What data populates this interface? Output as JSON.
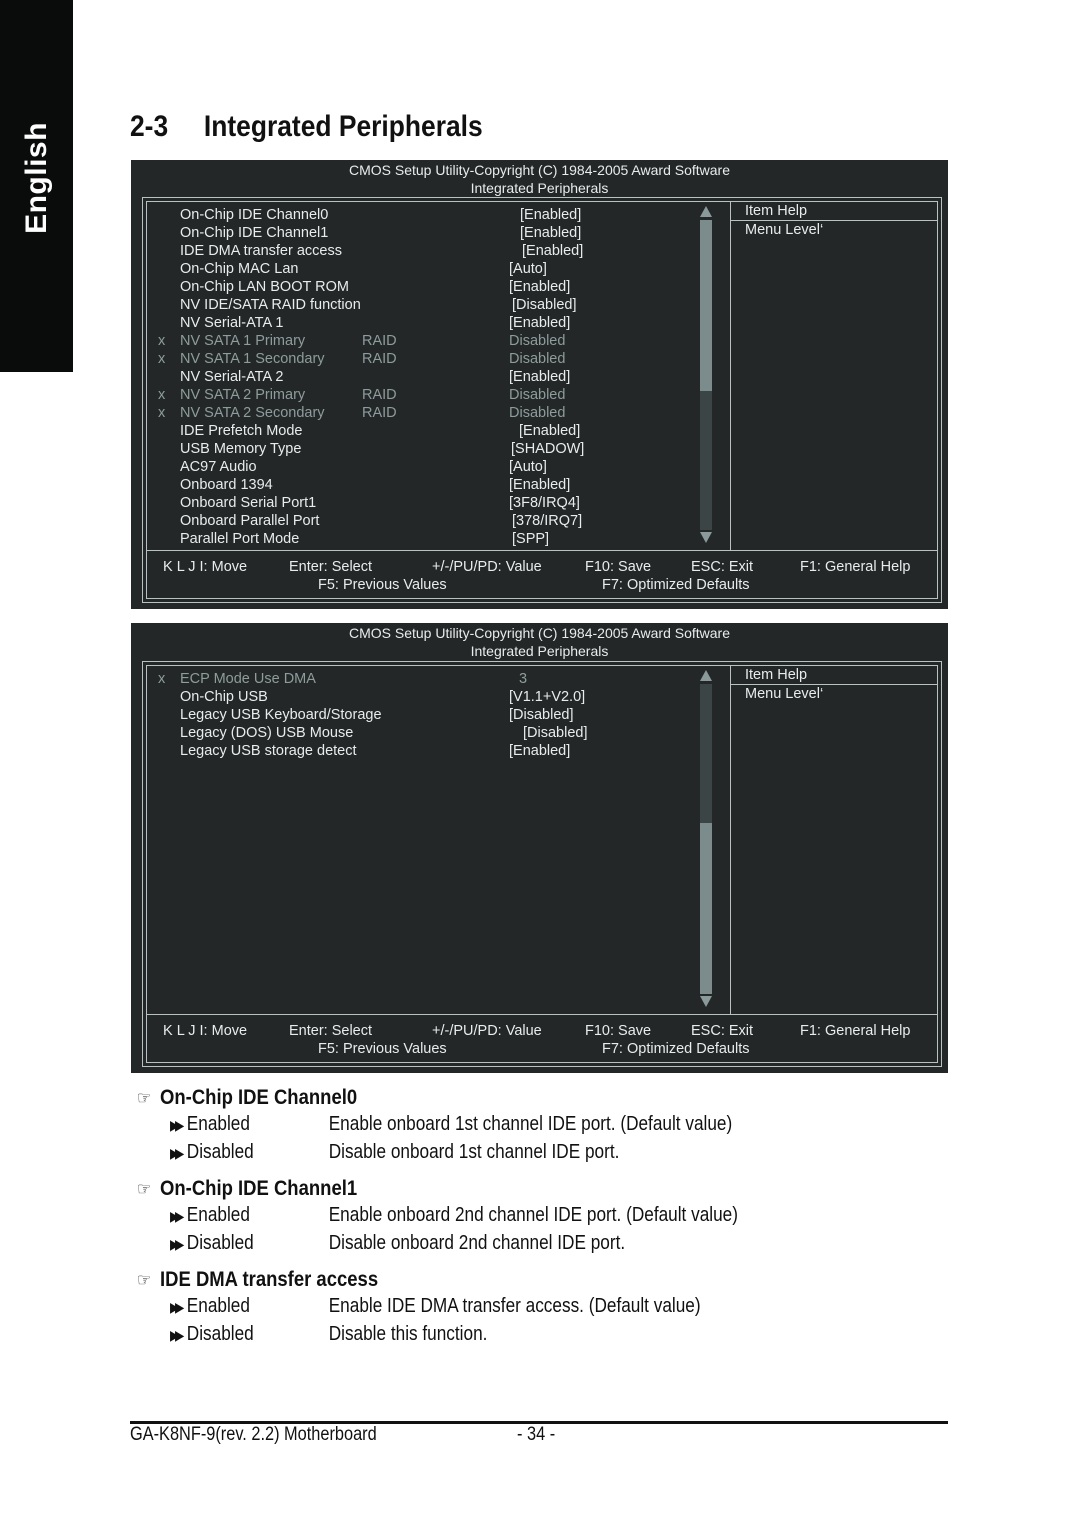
{
  "side_tab": {
    "label": "English"
  },
  "section": {
    "number": "2-3",
    "title": "Integrated Peripherals"
  },
  "bios_screens": [
    {
      "header_line1": "CMOS Setup Utility-Copyright (C) 1984-2005 Award Software",
      "header_line2": "Integrated Peripherals",
      "items": [
        {
          "prefix": "",
          "label": "On-Chip IDE Channel0",
          "raid": "",
          "value": "[Enabled]",
          "disabled": false
        },
        {
          "prefix": "",
          "label": "On-Chip IDE Channel1",
          "raid": "",
          "value": "[Enabled]",
          "disabled": false
        },
        {
          "prefix": "",
          "label": "IDE DMA transfer access",
          "raid": "",
          "value": "[Enabled]",
          "disabled": false
        },
        {
          "prefix": "",
          "label": "On-Chip MAC Lan",
          "raid": "",
          "value": "[Auto]",
          "disabled": false
        },
        {
          "prefix": "",
          "label": "On-Chip LAN BOOT ROM",
          "raid": "",
          "value": "[Enabled]",
          "disabled": false
        },
        {
          "prefix": "",
          "label": "NV IDE/SATA RAID function",
          "raid": "",
          "value": "[Disabled]",
          "disabled": false
        },
        {
          "prefix": "",
          "label": "NV Serial-ATA 1",
          "raid": "",
          "value": "[Enabled]",
          "disabled": false
        },
        {
          "prefix": "x",
          "label": "NV SATA 1 Primary",
          "raid": "RAID",
          "value": "Disabled",
          "disabled": true
        },
        {
          "prefix": "x",
          "label": "NV SATA 1 Secondary",
          "raid": "RAID",
          "value": "Disabled",
          "disabled": true
        },
        {
          "prefix": "",
          "label": "NV Serial-ATA 2",
          "raid": "",
          "value": "[Enabled]",
          "disabled": false
        },
        {
          "prefix": "x",
          "label": "NV SATA 2 Primary",
          "raid": "RAID",
          "value": "Disabled",
          "disabled": true
        },
        {
          "prefix": "x",
          "label": "NV SATA 2 Secondary",
          "raid": "RAID",
          "value": "Disabled",
          "disabled": true
        },
        {
          "prefix": "",
          "label": "IDE Prefetch Mode",
          "raid": "",
          "value": "[Enabled]",
          "disabled": false
        },
        {
          "prefix": "",
          "label": "USB Memory Type",
          "raid": "",
          "value": "[SHADOW]",
          "disabled": false
        },
        {
          "prefix": "",
          "label": "AC97 Audio",
          "raid": "",
          "value": "[Auto]",
          "disabled": false
        },
        {
          "prefix": "",
          "label": "Onboard 1394",
          "raid": "",
          "value": "[Enabled]",
          "disabled": false
        },
        {
          "prefix": "",
          "label": "Onboard Serial Port1",
          "raid": "",
          "value": "[3F8/IRQ4]",
          "disabled": false
        },
        {
          "prefix": "",
          "label": "Onboard Parallel Port",
          "raid": "",
          "value": "[378/IRQ7]",
          "disabled": false
        },
        {
          "prefix": "",
          "label": "Parallel Port Mode",
          "raid": "",
          "value": "[SPP]",
          "disabled": false
        }
      ],
      "scroll_position": "top",
      "scroll_thumb_fraction": 0.55,
      "item_help_title": "Item Help",
      "menu_level": "Menu Level‘",
      "footer": {
        "move": "K L J I: Move",
        "enter": "Enter: Select",
        "value": "+/-/PU/PD: Value",
        "save": "F10: Save",
        "exit": "ESC: Exit",
        "help": "F1: General Help",
        "previous": "F5: Previous Values",
        "defaults": "F7: Optimized Defaults"
      }
    },
    {
      "header_line1": "CMOS Setup Utility-Copyright (C) 1984-2005 Award Software",
      "header_line2": "Integrated Peripherals",
      "items": [
        {
          "prefix": "x",
          "label": "ECP Mode Use DMA",
          "raid": "",
          "value": "3",
          "disabled": true
        },
        {
          "prefix": "",
          "label": "On-Chip USB",
          "raid": "",
          "value": "[V1.1+V2.0]",
          "disabled": false
        },
        {
          "prefix": "",
          "label": "Legacy USB Keyboard/Storage",
          "raid": "",
          "value": "[Disabled]",
          "disabled": false
        },
        {
          "prefix": "",
          "label": "Legacy (DOS) USB Mouse",
          "raid": "",
          "value": "[Disabled]",
          "disabled": false
        },
        {
          "prefix": "",
          "label": "Legacy USB storage detect",
          "raid": "",
          "value": "[Enabled]",
          "disabled": false
        }
      ],
      "scroll_position": "bottom",
      "scroll_thumb_fraction": 0.55,
      "item_help_title": "Item Help",
      "menu_level": "Menu Level‘",
      "footer": {
        "move": "K L J I: Move",
        "enter": "Enter: Select",
        "value": "+/-/PU/PD: Value",
        "save": "F10: Save",
        "exit": "ESC: Exit",
        "help": "F1: General Help",
        "previous": "F5: Previous Values",
        "defaults": "F7: Optimized Defaults"
      }
    }
  ],
  "options": [
    {
      "title": "On-Chip IDE Channel0",
      "choices": [
        {
          "name": "Enabled",
          "desc": "Enable onboard 1st channel IDE port. (Default value)"
        },
        {
          "name": "Disabled",
          "desc": "Disable onboard 1st channel IDE port."
        }
      ]
    },
    {
      "title": "On-Chip IDE Channel1",
      "choices": [
        {
          "name": "Enabled",
          "desc": "Enable onboard 2nd channel IDE port. (Default value)"
        },
        {
          "name": "Disabled",
          "desc": "Disable onboard 2nd channel IDE port."
        }
      ]
    },
    {
      "title": "IDE DMA transfer access",
      "choices": [
        {
          "name": "Enabled",
          "desc": "Enable IDE DMA transfer access. (Default value)"
        },
        {
          "name": "Disabled",
          "desc": "Disable this function."
        }
      ]
    }
  ],
  "icons": {
    "bullet": "pointing-hand-icon",
    "choice": "double-arrow-icon",
    "scroll_up": "triangle-up-icon",
    "scroll_down": "triangle-down-icon"
  },
  "page_footer": {
    "model": "GA-K8NF-9(rev. 2.2) Motherboard",
    "page": "- 34 -"
  }
}
